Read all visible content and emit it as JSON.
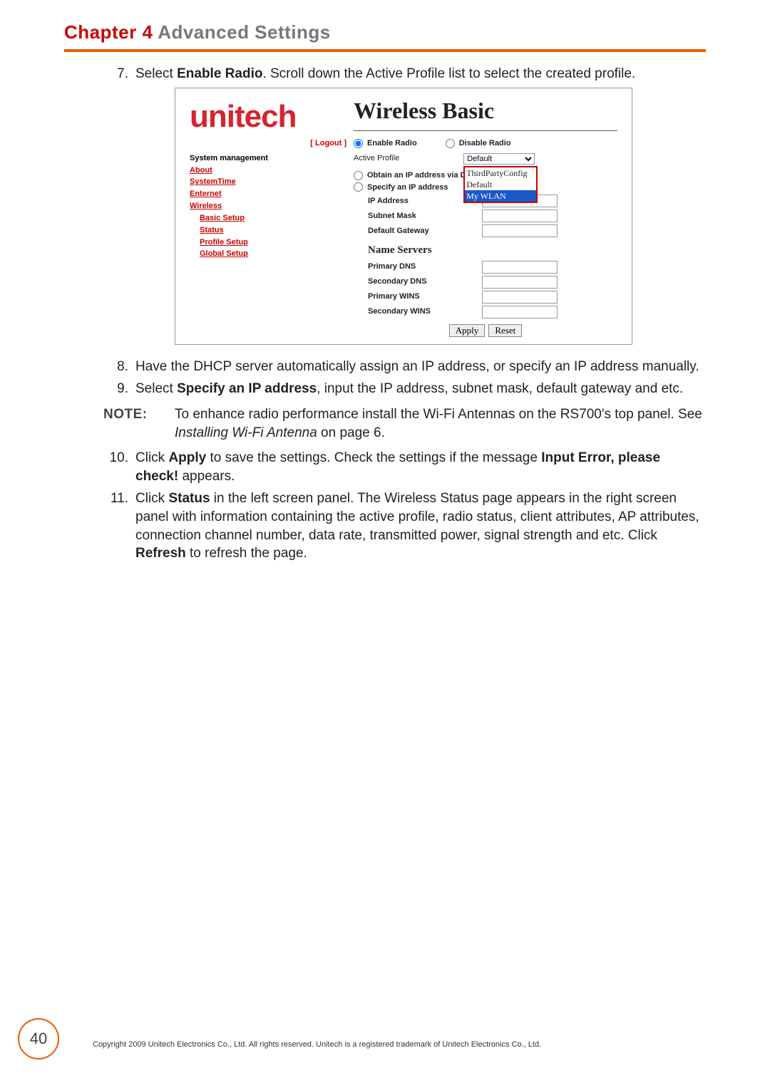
{
  "chapter": {
    "label": "Chapter 4",
    "title": "Advanced Settings"
  },
  "steps": {
    "s7_num": "7.",
    "s7_a": "Select ",
    "s7_b": "Enable Radio",
    "s7_c": ". Scroll down the Active Profile list to select the created profile.",
    "s8_num": "8.",
    "s8": "Have the DHCP server automatically assign an IP address, or specify an IP address manually.",
    "s9_num": "9.",
    "s9_a": "Select ",
    "s9_b": "Specify an IP address",
    "s9_c": ", input the IP address, subnet mask, default gateway and etc.",
    "note_label": "NOTE:",
    "note_a": "To enhance radio performance install the Wi-Fi Antennas on the RS700's top panel. See ",
    "note_b": "Installing Wi-Fi Antenna",
    "note_c": " on page 6.",
    "s10_num": "10.",
    "s10_a": "Click ",
    "s10_b": "Apply",
    "s10_c": " to save the settings. Check the settings if the message ",
    "s10_d": "Input Error, please check!",
    "s10_e": " appears.",
    "s11_num": "11.",
    "s11_a": "Click ",
    "s11_b": "Status",
    "s11_c": " in the left screen panel. The Wireless Status page appears in the right screen panel with information containing the active profile, radio status, client attributes, AP attributes, connection channel number, data rate, transmitted power, signal strength and etc. Click ",
    "s11_d": "Refresh",
    "s11_e": " to refresh the page."
  },
  "ui": {
    "brand": "unitech",
    "page_title": "Wireless Basic",
    "logout": "[ Logout ]",
    "nav_heading": "System management",
    "nav_about": "About",
    "nav_systime": "SystemTime",
    "nav_enternet": "Enternet",
    "nav_wireless": "Wireless",
    "nav_basic": "Basic Setup",
    "nav_status": "Status",
    "nav_profile": "Profile Setup",
    "nav_global": "Global Setup",
    "enable_radio": "Enable Radio",
    "disable_radio": "Disable Radio",
    "active_profile": "Active Profile",
    "profile_selected": "Default",
    "profile_opt1": "ThirdPartyConfig",
    "profile_opt2": "Default",
    "profile_opt3": "My WLAN",
    "obtain_dhcp": "Obtain an IP address via DHCP",
    "specify_ip": "Specify an IP address",
    "ip_address": "IP Address",
    "subnet_mask": "Subnet Mask",
    "default_gateway": "Default Gateway",
    "name_servers": "Name Servers",
    "primary_dns": "Primary DNS",
    "secondary_dns": "Secondary DNS",
    "primary_wins": "Primary WINS",
    "secondary_wins": "Secondary WINS",
    "apply": "Apply",
    "reset": "Reset"
  },
  "footer": {
    "page_number": "40",
    "copyright": "Copyright 2009 Unitech Electronics Co., Ltd. All rights reserved. Unitech is a registered trademark of Unitech Electronics Co., Ltd."
  }
}
